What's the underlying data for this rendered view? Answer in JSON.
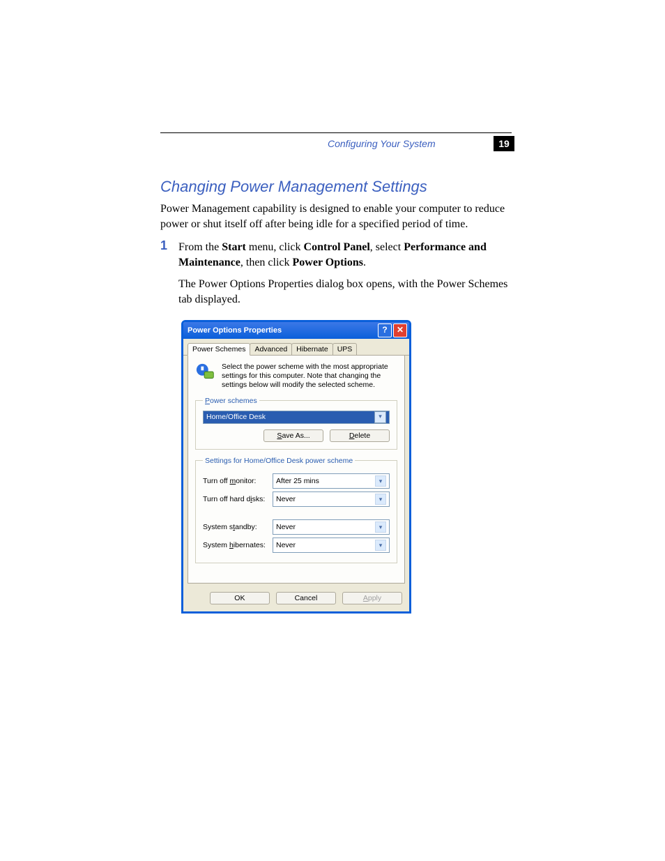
{
  "header": {
    "running_head": "Configuring Your System",
    "page_number": "19"
  },
  "section": {
    "title": "Changing Power Management Settings",
    "intro": "Power Management capability is designed to enable your computer to reduce power or shut itself off after being idle for a specified period of time."
  },
  "step1": {
    "number": "1",
    "prefix": "From the ",
    "b1": "Start",
    "t1": " menu, click ",
    "b2": "Control Panel",
    "t2": ", select ",
    "b3": "Performance and Maintenance",
    "t3": ", then click ",
    "b4": "Power Options",
    "t4": ".",
    "result": "The Power Options Properties dialog box opens, with the Power Schemes tab displayed."
  },
  "dialog": {
    "title": "Power Options Properties",
    "tabs": [
      "Power Schemes",
      "Advanced",
      "Hibernate",
      "UPS"
    ],
    "description": "Select the power scheme with the most appropriate settings for this computer. Note that changing the settings below will modify the selected scheme.",
    "schemes_legend": "Power schemes",
    "scheme_selected": "Home/Office Desk",
    "save_as": "Save As...",
    "delete": "Delete",
    "settings_legend": "Settings for Home/Office Desk power scheme",
    "rows": {
      "monitor_label": "Turn off monitor:",
      "monitor_value": "After 25 mins",
      "disks_label": "Turn off hard disks:",
      "disks_value": "Never",
      "standby_label": "System standby:",
      "standby_value": "Never",
      "hibernate_label": "System hibernates:",
      "hibernate_value": "Never"
    },
    "footer": {
      "ok": "OK",
      "cancel": "Cancel",
      "apply": "Apply"
    }
  }
}
